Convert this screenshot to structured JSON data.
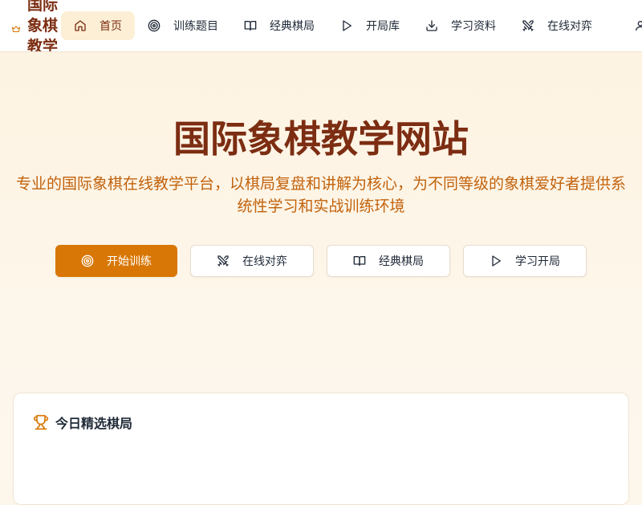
{
  "brand": {
    "name": "国际象棋教学",
    "icon": "crown-icon",
    "color": "#7c2d12"
  },
  "nav": {
    "items": [
      {
        "label": "首页",
        "icon": "home-icon",
        "active": true
      },
      {
        "label": "训练题目",
        "icon": "target-icon",
        "active": false
      },
      {
        "label": "经典棋局",
        "icon": "book-open-icon",
        "active": false
      },
      {
        "label": "开局库",
        "icon": "play-icon",
        "active": false
      },
      {
        "label": "学习资料",
        "icon": "download-icon",
        "active": false
      },
      {
        "label": "在线对弈",
        "icon": "swords-icon",
        "active": false
      }
    ],
    "user_icon": "user-icon"
  },
  "hero": {
    "title": "国际象棋教学网站",
    "subtitle": "专业的国际象棋在线教学平台，以棋局复盘和讲解为核心，为不同等级的象棋爱好者提供系统性学习和实战训练环境",
    "buttons": [
      {
        "label": "开始训练",
        "icon": "target-icon",
        "primary": true
      },
      {
        "label": "在线对弈",
        "icon": "swords-icon",
        "primary": false
      },
      {
        "label": "经典棋局",
        "icon": "book-open-icon",
        "primary": false
      },
      {
        "label": "学习开局",
        "icon": "play-icon",
        "primary": false
      }
    ]
  },
  "featured": {
    "title": "今日精选棋局",
    "icon": "trophy-icon"
  },
  "colors": {
    "accent": "#d97706",
    "title": "#7c2d12",
    "subtitle": "#c2620c",
    "background": "#fdf6ea"
  }
}
